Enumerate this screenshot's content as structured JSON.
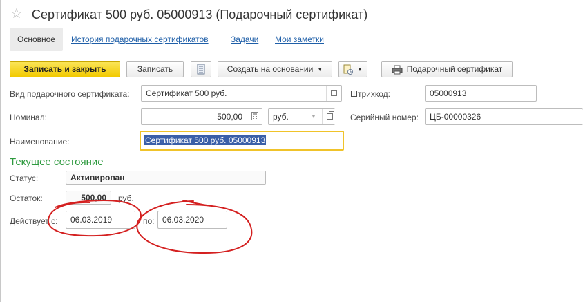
{
  "window": {
    "title": "Сертификат 500 руб. 05000913 (Подарочный сертификат)"
  },
  "tabs": [
    {
      "label": "Основное"
    },
    {
      "label": "История подарочных сертификатов"
    },
    {
      "label": "Задачи"
    },
    {
      "label": "Мои заметки"
    }
  ],
  "toolbar": {
    "save_close": "Записать и закрыть",
    "save": "Записать",
    "create_based_on": "Создать на основании",
    "print": "Подарочный сертификат"
  },
  "form": {
    "type_label": "Вид подарочного сертификата:",
    "type_value": "Сертификат 500 руб.",
    "barcode_label": "Штрихкод:",
    "barcode_value": "05000913",
    "nominal_label": "Номинал:",
    "nominal_value": "500,00",
    "currency_value": "руб.",
    "serial_label": "Серийный номер:",
    "serial_value": "ЦБ-00000326",
    "name_label": "Наименование:",
    "name_value": "Сертификат 500 руб. 05000913"
  },
  "state": {
    "section_title": "Текущее состояние",
    "status_label": "Статус:",
    "status_value": "Активирован",
    "balance_label": "Остаток:",
    "balance_value": "500,00",
    "balance_unit": "руб.",
    "valid_from_label": "Действует с:",
    "valid_from_value": "06.03.2019",
    "valid_to_label": "по:",
    "valid_to_value": "06.03.2020"
  },
  "colors": {
    "primary_button": "#f2c900",
    "link": "#1f5fa8",
    "section_title": "#2e9a3f",
    "annotation": "#d42020",
    "focus_border": "#f0c32a"
  }
}
